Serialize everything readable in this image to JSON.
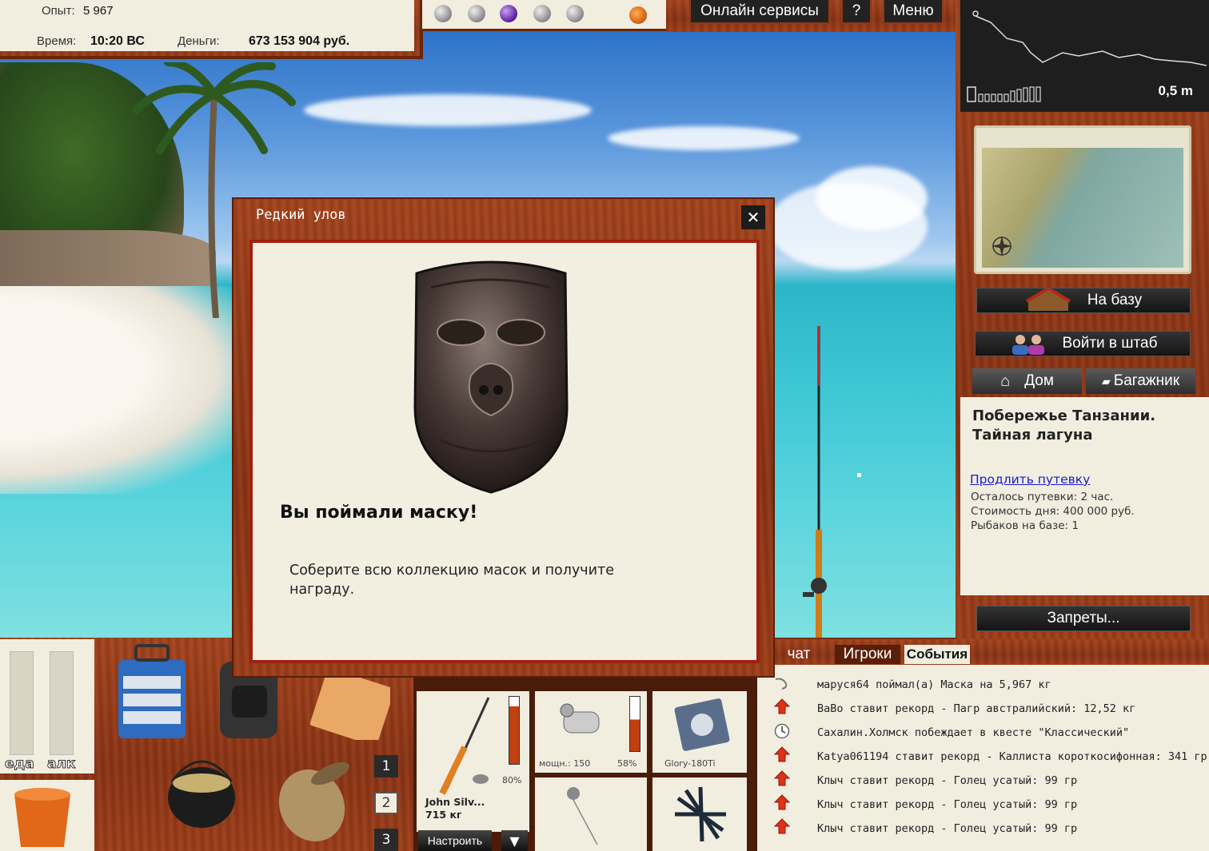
{
  "stats": {
    "exp_label": "Опыт:",
    "exp_value": "5 967",
    "time_label": "Время:",
    "time_value": "10:20 ВС",
    "money_label": "Деньги:",
    "money_value": "673 153 904 руб."
  },
  "top_menu": {
    "online_label": "Онлайн сервисы",
    "help_label": "?",
    "menu_label": "Меню"
  },
  "depth": {
    "value": "0,5 m"
  },
  "right": {
    "to_base_label": "На базу",
    "hq_label": "Войти в штаб",
    "home_label": "Дом",
    "trunk_label": "Багажник",
    "location_title": "Побережье Танзании. Тайная лагуна",
    "extend_link": "Продлить путевку",
    "info_time_left": "Осталось путевки: 2 час.",
    "info_day_cost": "Стоимость дня: 400 000 руб.",
    "info_fishers": "Рыбаков на базе: 1",
    "bans_label": "Запреты..."
  },
  "dialog": {
    "title": "Редкий улов",
    "close": "✕",
    "headline": "Вы поймали маску!",
    "body": "Соберите всю коллекцию масок и получите награду."
  },
  "needs": {
    "food_label": "еда",
    "alcohol_label": "алк"
  },
  "slots": {
    "numbers": [
      "1",
      "2",
      "3"
    ]
  },
  "tackle": {
    "rod_name": "John Silv...",
    "rod_weight": "715 кг",
    "rod_percent": "80%",
    "reel_power": "мощн.: 150",
    "reel_percent": "58%",
    "line_name": "Glory-180Ti",
    "setup_label": "Настроить",
    "dropdown": "▼"
  },
  "events": {
    "tabs": [
      "чат",
      "Игроки",
      "События"
    ],
    "items": [
      {
        "icon": "hook-icon",
        "text": "маруся64 поймал(а) Маска на 5,967 кг"
      },
      {
        "icon": "record-arrow-icon",
        "text": "BaBo ставит рекорд - Пагр австралийский: 12,52 кг"
      },
      {
        "icon": "clock-icon",
        "text": "Сахалин.Холмск побеждает в квесте \"Классический\""
      },
      {
        "icon": "record-arrow-icon",
        "text": "Katya061194 ставит рекорд - Каллиста короткосифонная: 341 гр"
      },
      {
        "icon": "record-arrow-icon",
        "text": "Клыч ставит рекорд - Голец усатый: 99 гр"
      },
      {
        "icon": "record-arrow-icon",
        "text": "Клыч ставит рекорд - Голец усатый: 99 гр"
      },
      {
        "icon": "record-arrow-icon",
        "text": "Клыч ставит рекорд - Голец усатый: 99 гр"
      }
    ]
  }
}
